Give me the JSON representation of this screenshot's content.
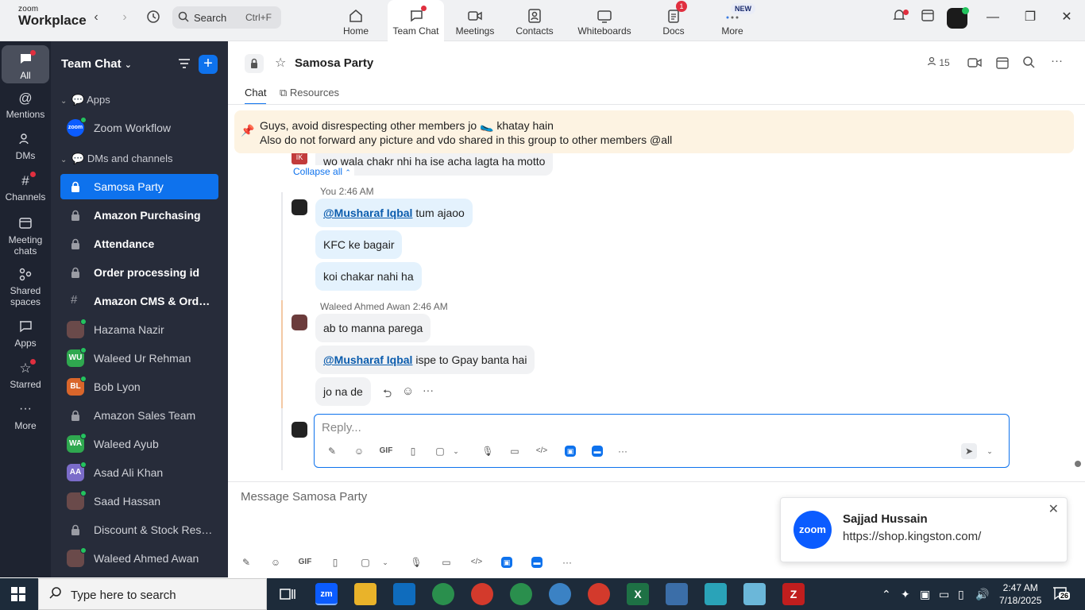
{
  "topbar": {
    "logo_line1": "zoom",
    "logo_line2": "Workplace",
    "search_label": "Search",
    "search_shortcut": "Ctrl+F",
    "tabs": [
      {
        "label": "Home",
        "icon": "home-icon"
      },
      {
        "label": "Team Chat",
        "icon": "chat-icon"
      },
      {
        "label": "Meetings",
        "icon": "video-icon"
      },
      {
        "label": "Contacts",
        "icon": "contacts-icon"
      },
      {
        "label": "Whiteboards",
        "icon": "whiteboard-icon"
      },
      {
        "label": "Docs",
        "icon": "docs-icon",
        "badge": "1"
      },
      {
        "label": "More",
        "icon": "more-icon",
        "badge": "NEW"
      }
    ]
  },
  "rail": {
    "items": [
      {
        "label": "All"
      },
      {
        "label": "Mentions"
      },
      {
        "label": "DMs"
      },
      {
        "label": "Channels"
      },
      {
        "label": "Meeting chats"
      },
      {
        "label": "Shared spaces"
      },
      {
        "label": "Apps"
      },
      {
        "label": "Starred"
      },
      {
        "label": "More"
      }
    ]
  },
  "sidebar": {
    "title": "Team Chat",
    "sections": {
      "apps": "Apps",
      "dms": "DMs and channels"
    },
    "apps": [
      {
        "label": "Zoom Workflow",
        "avatar": "zoom"
      }
    ],
    "items": [
      {
        "label": "Samosa Party",
        "type": "lock",
        "active": true
      },
      {
        "label": "Amazon Purchasing",
        "type": "lock",
        "bold": true
      },
      {
        "label": "Attendance",
        "type": "lock",
        "bold": true
      },
      {
        "label": "Order processing id",
        "type": "lock",
        "bold": true
      },
      {
        "label": "Amazon CMS & Order...",
        "type": "hash",
        "bold": true
      },
      {
        "label": "Hazama Nazir",
        "type": "photo"
      },
      {
        "label": "Waleed Ur Rehman",
        "type": "initials",
        "initials": "WU"
      },
      {
        "label": "Bob Lyon",
        "type": "initials",
        "initials": "BL"
      },
      {
        "label": "Amazon Sales Team",
        "type": "lock"
      },
      {
        "label": "Waleed Ayub",
        "type": "initials",
        "initials": "WA"
      },
      {
        "label": "Asad Ali Khan",
        "type": "initials",
        "initials": "AA"
      },
      {
        "label": "Saad Hassan",
        "type": "photo"
      },
      {
        "label": "Discount & Stock Reser...",
        "type": "lock"
      },
      {
        "label": "Waleed Ahmed Awan",
        "type": "photo"
      }
    ]
  },
  "chat": {
    "title": "Samosa Party",
    "member_count": "15",
    "tabs": [
      "Chat",
      "Resources"
    ],
    "pinned_line1": "Guys, avoid disrespecting other members jo 🥿 khatay hain",
    "pinned_line2": "Also do not forward any picture and vdo shared in this group to other members @all",
    "prev_message": "wo wala chakr nhi ha ise acha lagta ha motto",
    "collapse_label": "Collapse all",
    "group1_meta": "You 2:46 AM",
    "group1_msg1_mention": "@Musharaf Iqbal",
    "group1_msg1_text": " tum ajaoo",
    "group1_msg2": "KFC ke bagair",
    "group1_msg3": "koi chakar nahi ha",
    "group2_meta": "Waleed Ahmed Awan 2:46 AM",
    "group2_msg1": "ab to manna parega",
    "group2_msg2_mention": "@Musharaf Iqbal",
    "group2_msg2_text": " ispe to Gpay banta hai",
    "group2_msg3": "jo na de",
    "reply_placeholder": "Reply...",
    "compose_placeholder": "Message Samosa Party"
  },
  "toast": {
    "logo": "zoom",
    "name": "Sajjad Hussain",
    "message": "https://shop.kingston.com/"
  },
  "taskbar": {
    "search_placeholder": "Type here to search",
    "time": "2:47 AM",
    "date": "7/18/2025",
    "notif_count": "26"
  },
  "colors": {
    "accent": "#0e72ed",
    "sidebar_bg": "#272c3a",
    "rail_bg": "#1e2330",
    "pinned_bg": "#fdf3e2",
    "bubble_bg": "#e4f2fd"
  }
}
